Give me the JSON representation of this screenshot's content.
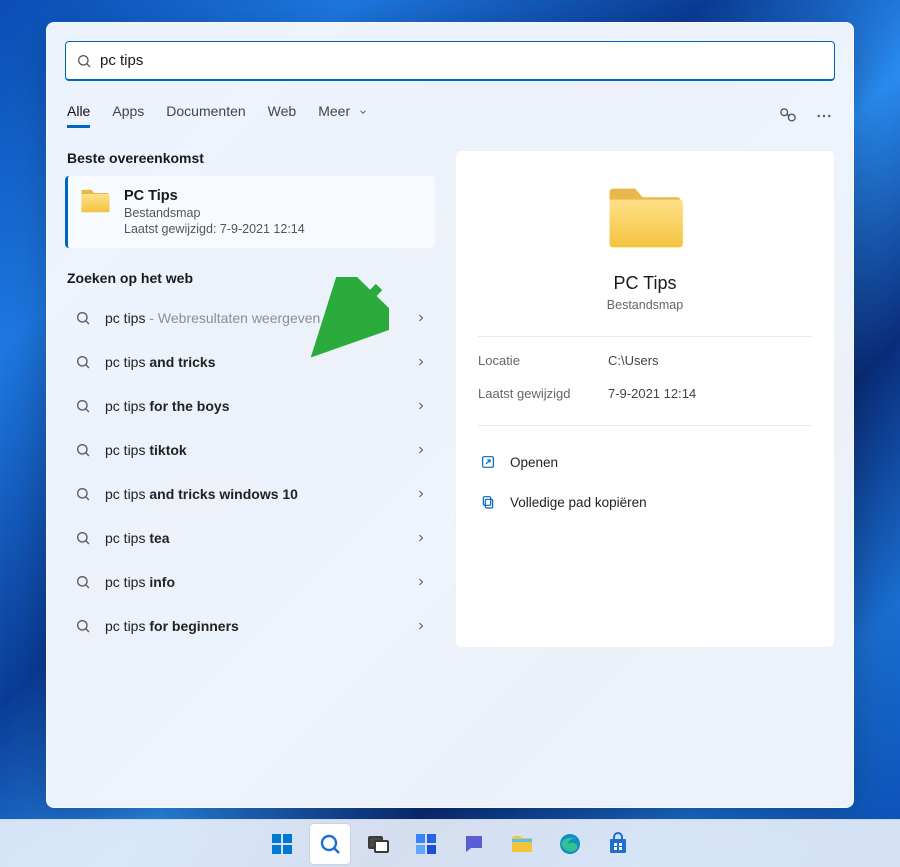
{
  "search": {
    "value": "pc tips"
  },
  "tabs": {
    "all": "Alle",
    "apps": "Apps",
    "documents": "Documenten",
    "web": "Web",
    "more": "Meer"
  },
  "sections": {
    "best_match": "Beste overeenkomst",
    "web_search": "Zoeken op het web"
  },
  "best": {
    "title": "PC Tips",
    "type": "Bestandsmap",
    "modified_label": "Laatst gewijzigd:",
    "modified_value": "7-9-2021 12:14"
  },
  "web_results": [
    {
      "prefix": "pc tips",
      "bold": "",
      "gray": " - Webresultaten weergeven"
    },
    {
      "prefix": "pc tips ",
      "bold": "and tricks",
      "gray": ""
    },
    {
      "prefix": "pc tips ",
      "bold": "for the boys",
      "gray": ""
    },
    {
      "prefix": "pc tips ",
      "bold": "tiktok",
      "gray": ""
    },
    {
      "prefix": "pc tips ",
      "bold": "and tricks windows 10",
      "gray": ""
    },
    {
      "prefix": "pc tips ",
      "bold": "tea",
      "gray": ""
    },
    {
      "prefix": "pc tips ",
      "bold": "info",
      "gray": ""
    },
    {
      "prefix": "pc tips ",
      "bold": "for beginners",
      "gray": ""
    }
  ],
  "preview": {
    "title": "PC Tips",
    "subtitle": "Bestandsmap",
    "location_label": "Locatie",
    "location_value": "C:\\Users",
    "modified_label": "Laatst gewijzigd",
    "modified_value": "7-9-2021 12:14",
    "open": "Openen",
    "copy_path": "Volledige pad kopiëren"
  }
}
